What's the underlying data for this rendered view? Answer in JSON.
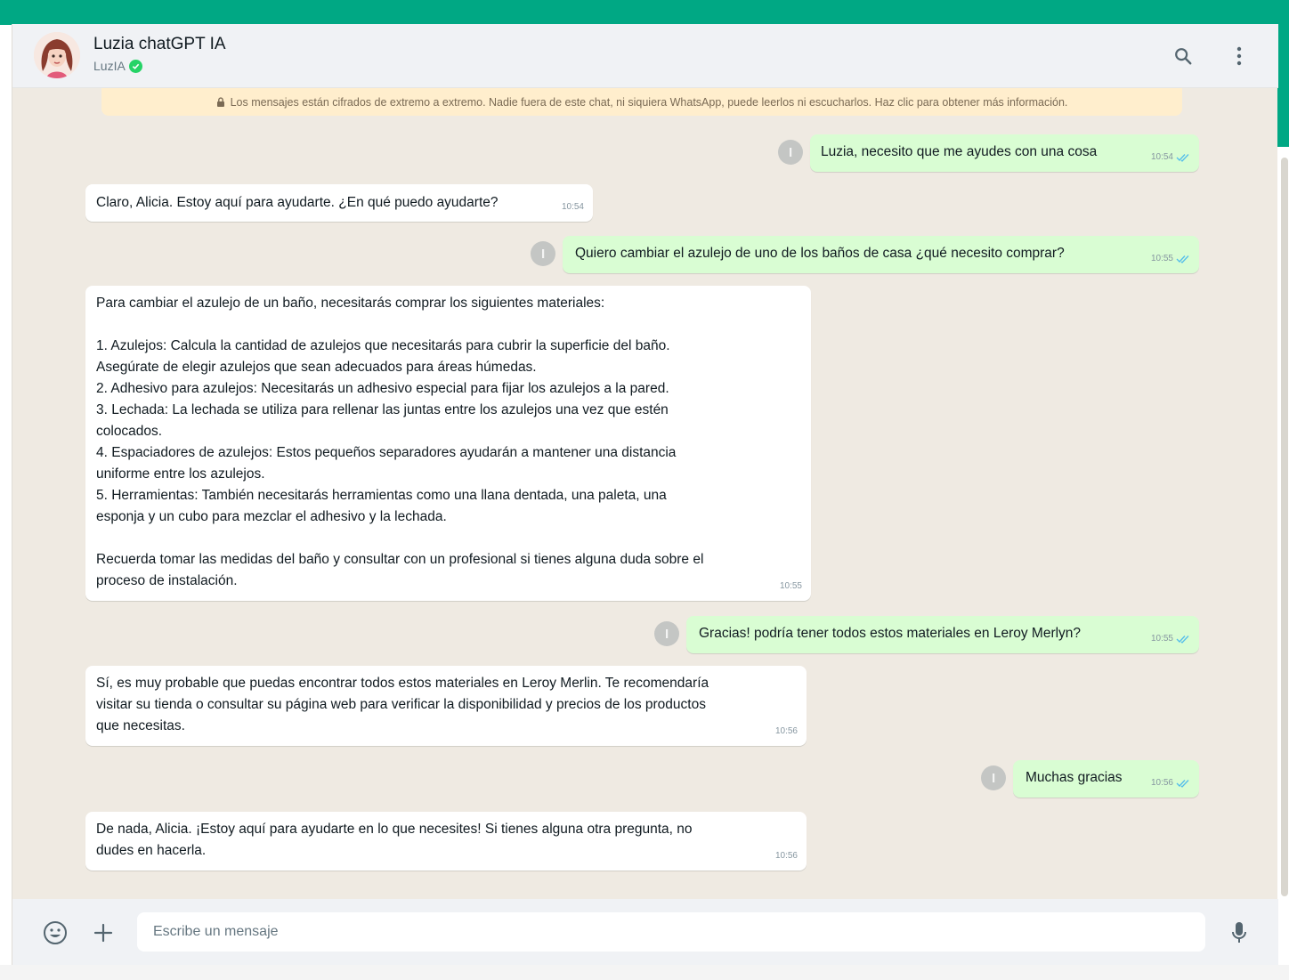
{
  "header": {
    "chat_name": "Luzia chatGPT IA",
    "subtitle": "LuzIA",
    "icons": {
      "search": "search-icon",
      "menu": "kebab-menu-icon",
      "verified": "verified-badge-icon"
    }
  },
  "encryption_notice": "Los mensajes están cifrados de extremo a extremo. Nadie fuera de este chat, ni siquiera WhatsApp, puede leerlos ni escucharlos. Haz clic para obtener más información.",
  "messages": [
    {
      "dir": "out",
      "text": "Luzia, necesito que me ayudes con una cosa",
      "time": "10:54"
    },
    {
      "dir": "in",
      "text": "Claro, Alicia. Estoy aquí para ayudarte. ¿En qué puedo ayudarte?",
      "time": "10:54"
    },
    {
      "dir": "out",
      "text": "Quiero cambiar el azulejo de uno de los baños de casa ¿qué necesito comprar?",
      "time": "10:55"
    },
    {
      "dir": "in",
      "text": "Para cambiar el azulejo de un baño, necesitarás comprar los siguientes materiales:\n\n1. Azulejos: Calcula la cantidad de azulejos que necesitarás para cubrir la superficie del baño.\nAsegúrate de elegir azulejos que sean adecuados para áreas húmedas.\n2. Adhesivo para azulejos: Necesitarás un adhesivo especial para fijar los azulejos a la pared.\n3. Lechada: La lechada se utiliza para rellenar las juntas entre los azulejos una vez que estén\ncolocados.\n4. Espaciadores de azulejos: Estos pequeños separadores ayudarán a mantener una distancia\nuniforme entre los azulejos.\n5. Herramientas: También necesitarás herramientas como una llana dentada, una paleta, una\nesponja y un cubo para mezclar el adhesivo y la lechada.\n\nRecuerda tomar las medidas del baño y consultar con un profesional si tienes alguna duda sobre el\nproceso de instalación.",
      "time": "10:55"
    },
    {
      "dir": "out",
      "text": "Gracias! podría tener todos estos materiales en Leroy Merlyn?",
      "time": "10:55"
    },
    {
      "dir": "in",
      "text": "Sí, es muy probable que puedas encontrar todos estos materiales en Leroy Merlin. Te recomendaría\nvisitar su tienda o consultar su página web para verificar la disponibilidad y precios de los productos\nque necesitas.",
      "time": "10:56"
    },
    {
      "dir": "out",
      "text": "Muchas gracias",
      "time": "10:56"
    },
    {
      "dir": "in",
      "text": "De nada, Alicia. ¡Estoy aquí para ayudarte en lo que necesites! Si tienes alguna otra pregunta, no\ndudes en hacerla.",
      "time": "10:56"
    }
  ],
  "composer": {
    "placeholder": "Escribe un mensaje",
    "icons": {
      "emoji": "emoji-icon",
      "attach": "plus-icon",
      "mic": "microphone-icon"
    }
  },
  "colors": {
    "accent": "#00a884",
    "chat_bg": "#efeae2",
    "outgoing_bubble": "#d9fdd3",
    "incoming_bubble": "#ffffff",
    "encryption_banner": "#ffeecd",
    "read_ticks": "#53bdeb"
  }
}
